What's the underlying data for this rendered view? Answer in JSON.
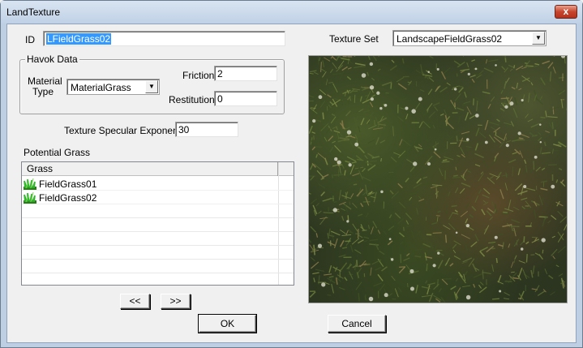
{
  "window": {
    "title": "LandTexture",
    "close_glyph": "x"
  },
  "id_field": {
    "label": "ID",
    "value": "LFieldGrass02"
  },
  "texture_set": {
    "label": "Texture Set",
    "selected": "LandscapeFieldGrass02"
  },
  "havok": {
    "group_label": "Havok Data",
    "material_label_line1": "Material",
    "material_label_line2": "Type",
    "material_selected": "MaterialGrass",
    "friction_label": "Friction",
    "friction_value": "2",
    "restitution_label": "Restitution",
    "restitution_value": "0"
  },
  "specular": {
    "label": "Texture Specular Exponent",
    "value": "30"
  },
  "potential_grass": {
    "label": "Potential Grass",
    "column_header": "Grass",
    "items": [
      "FieldGrass01",
      "FieldGrass02"
    ],
    "item_icon": "grass-icon"
  },
  "buttons": {
    "move_left": "<<",
    "move_right": ">>",
    "ok": "OK",
    "cancel": "Cancel"
  },
  "colors": {
    "selection": "#3399ff",
    "preview_base": "#2c3520"
  }
}
